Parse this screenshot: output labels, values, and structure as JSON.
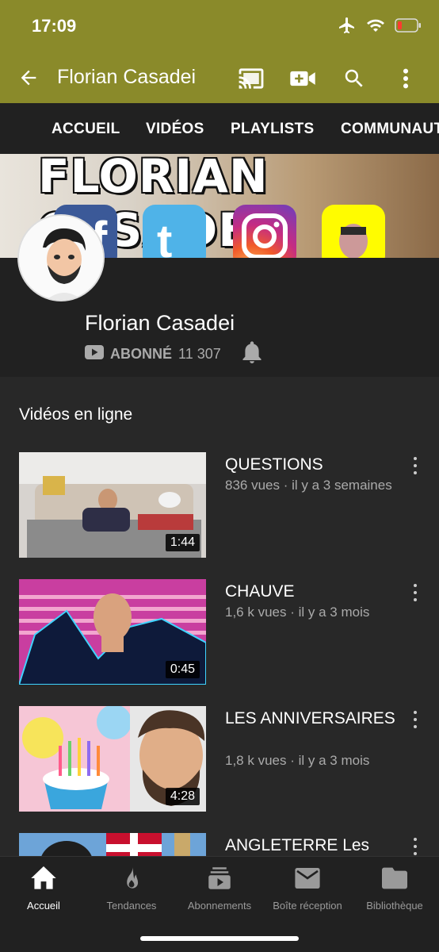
{
  "status_bar": {
    "time": "17:09"
  },
  "app_bar": {
    "title": "Florian Casadei"
  },
  "tabs": [
    {
      "label": "ACCUEIL"
    },
    {
      "label": "VIDÉOS"
    },
    {
      "label": "PLAYLISTS"
    },
    {
      "label": "COMMUNAUTÉ"
    }
  ],
  "banner": {
    "text": "FLORIAN CASADEI"
  },
  "channel": {
    "name": "Florian Casadei",
    "subscribed_label": "ABONNÉ",
    "subscriber_count": "11 307"
  },
  "section": {
    "title": "Vidéos en ligne"
  },
  "videos": [
    {
      "title": "QUESTIONS",
      "meta": "836 vues · il y a 3 semaines",
      "duration": "1:44"
    },
    {
      "title": "CHAUVE",
      "meta": "1,6 k vues · il y a 3 mois",
      "duration": "0:45"
    },
    {
      "title": "LES ANNIVERSAIRES",
      "meta": "1,8 k vues · il y a 3 mois",
      "duration": "4:28"
    },
    {
      "title": "ANGLETERRE Les",
      "meta": "",
      "duration": ""
    }
  ],
  "bottom_nav": [
    {
      "label": "Accueil",
      "icon": "home-icon"
    },
    {
      "label": "Tendances",
      "icon": "flame-icon"
    },
    {
      "label": "Abonnements",
      "icon": "subscriptions-icon"
    },
    {
      "label": "Boîte réception",
      "icon": "inbox-icon"
    },
    {
      "label": "Bibliothèque",
      "icon": "library-icon"
    }
  ],
  "colors": {
    "app_bar": "#8a8a2a",
    "background": "#282828",
    "surface": "#212121",
    "secondary_text": "#aaaaaa"
  }
}
